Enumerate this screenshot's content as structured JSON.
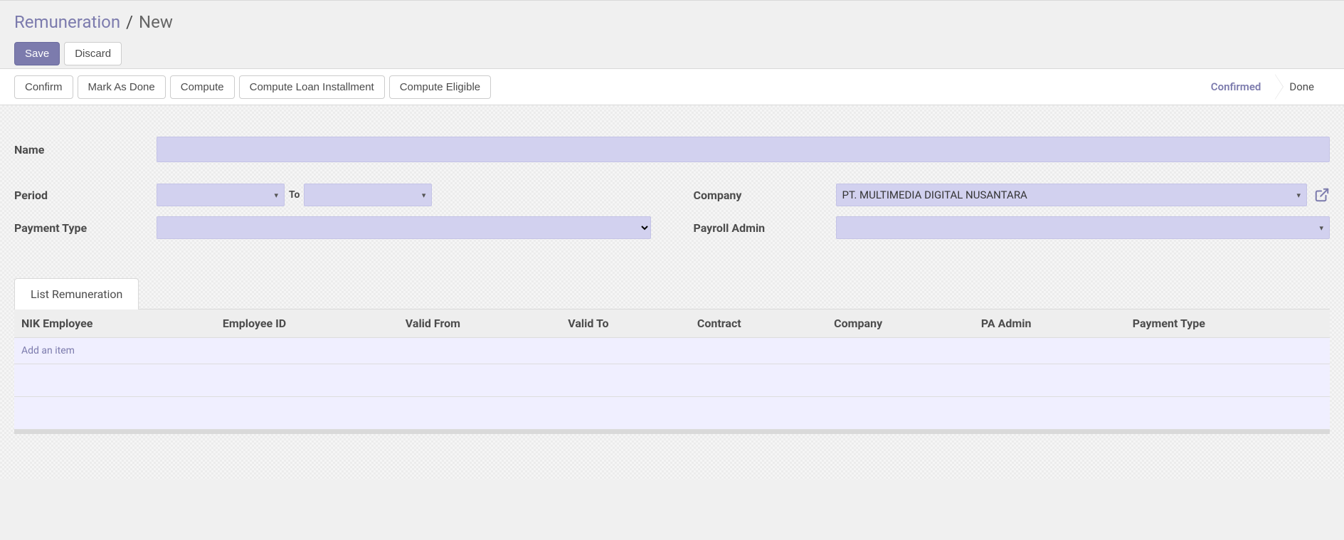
{
  "breadcrumb": {
    "root": "Remuneration",
    "sep": "/",
    "current": "New"
  },
  "actions": {
    "save": "Save",
    "discard": "Discard"
  },
  "statusbar": {
    "buttons": {
      "confirm": "Confirm",
      "mark_done": "Mark As Done",
      "compute": "Compute",
      "compute_loan": "Compute Loan Installment",
      "compute_eligible": "Compute Eligible"
    },
    "steps": {
      "confirmed": "Confirmed",
      "done": "Done"
    }
  },
  "fields": {
    "name_label": "Name",
    "name_value": "",
    "period_label": "Period",
    "period_from": "",
    "period_to": "",
    "period_to_word": "To",
    "payment_type_label": "Payment Type",
    "payment_type_value": "",
    "company_label": "Company",
    "company_value": "PT. MULTIMEDIA DIGITAL NUSANTARA",
    "payroll_admin_label": "Payroll Admin",
    "payroll_admin_value": ""
  },
  "notebook": {
    "tab_label": "List Remuneration"
  },
  "table": {
    "headers": {
      "nik": "NIK Employee",
      "emp_id": "Employee ID",
      "valid_from": "Valid From",
      "valid_to": "Valid To",
      "contract": "Contract",
      "company": "Company",
      "pa_admin": "PA Admin",
      "payment_type": "Payment Type"
    },
    "add_item": "Add an item"
  }
}
